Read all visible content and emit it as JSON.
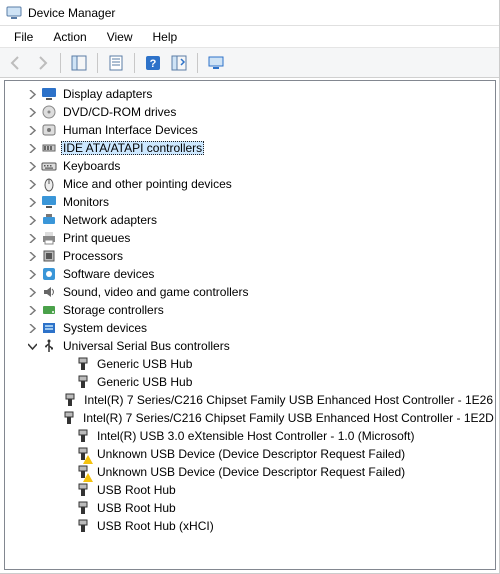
{
  "window": {
    "title": "Device Manager"
  },
  "menu": {
    "file": "File",
    "action": "Action",
    "view": "View",
    "help": "Help"
  },
  "categories": [
    {
      "id": "display-adapters",
      "label": "Display adapters",
      "icon": "display",
      "expanded": false
    },
    {
      "id": "dvd-cdrom",
      "label": "DVD/CD-ROM drives",
      "icon": "disc",
      "expanded": false
    },
    {
      "id": "hid",
      "label": "Human Interface Devices",
      "icon": "hi",
      "expanded": false
    },
    {
      "id": "ide-atapi",
      "label": "IDE ATA/ATAPI controllers",
      "icon": "ide",
      "expanded": false,
      "selected": true
    },
    {
      "id": "keyboards",
      "label": "Keyboards",
      "icon": "keyboard",
      "expanded": false
    },
    {
      "id": "mice",
      "label": "Mice and other pointing devices",
      "icon": "mouse",
      "expanded": false
    },
    {
      "id": "monitors",
      "label": "Monitors",
      "icon": "monitor",
      "expanded": false
    },
    {
      "id": "network",
      "label": "Network adapters",
      "icon": "net",
      "expanded": false
    },
    {
      "id": "print-queues",
      "label": "Print queues",
      "icon": "printer",
      "expanded": false
    },
    {
      "id": "processors",
      "label": "Processors",
      "icon": "cpu",
      "expanded": false
    },
    {
      "id": "software-devices",
      "label": "Software devices",
      "icon": "sw",
      "expanded": false
    },
    {
      "id": "sound",
      "label": "Sound, video and game controllers",
      "icon": "sound",
      "expanded": false
    },
    {
      "id": "storage",
      "label": "Storage controllers",
      "icon": "storage",
      "expanded": false
    },
    {
      "id": "system",
      "label": "System devices",
      "icon": "system",
      "expanded": false
    },
    {
      "id": "usb",
      "label": "Universal Serial Bus controllers",
      "icon": "usb",
      "expanded": true,
      "children": [
        {
          "label": "Generic USB Hub",
          "warn": false
        },
        {
          "label": "Generic USB Hub",
          "warn": false
        },
        {
          "label": "Intel(R) 7 Series/C216 Chipset Family USB Enhanced Host Controller - 1E26",
          "warn": false
        },
        {
          "label": "Intel(R) 7 Series/C216 Chipset Family USB Enhanced Host Controller - 1E2D",
          "warn": false
        },
        {
          "label": "Intel(R) USB 3.0 eXtensible Host Controller - 1.0 (Microsoft)",
          "warn": false
        },
        {
          "label": "Unknown USB Device (Device Descriptor Request Failed)",
          "warn": true
        },
        {
          "label": "Unknown USB Device (Device Descriptor Request Failed)",
          "warn": true
        },
        {
          "label": "USB Root Hub",
          "warn": false
        },
        {
          "label": "USB Root Hub",
          "warn": false
        },
        {
          "label": "USB Root Hub (xHCI)",
          "warn": false
        }
      ]
    }
  ]
}
